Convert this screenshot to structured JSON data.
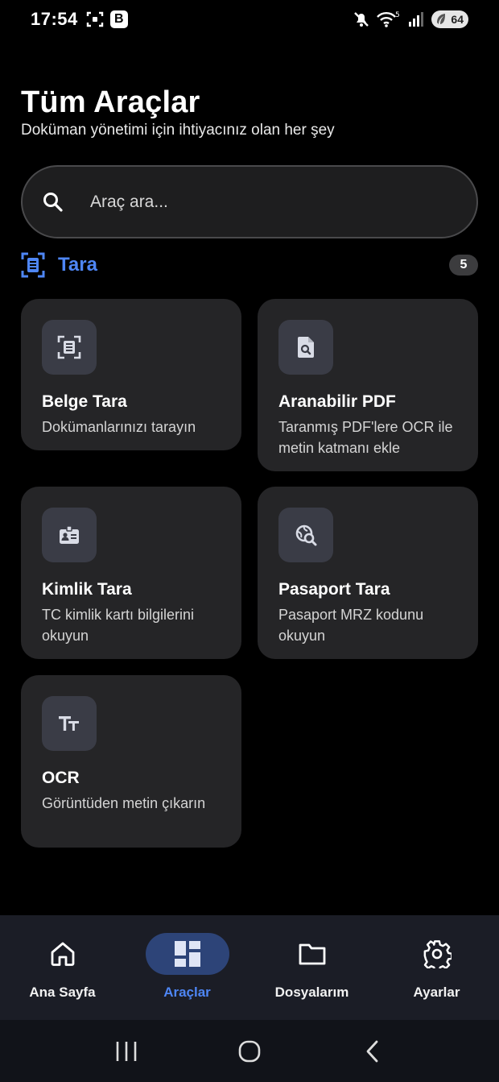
{
  "status_bar": {
    "time": "17:54",
    "badge_letter": "B",
    "wifi_level": "5",
    "battery": "64"
  },
  "header": {
    "title": "Tüm Araçlar",
    "subtitle": "Doküman yönetimi için ihtiyacınız olan her şey"
  },
  "search": {
    "placeholder": "Araç ara..."
  },
  "section": {
    "title": "Tara",
    "count": "5",
    "accent_color": "#4e86f5"
  },
  "tools": [
    {
      "icon": "document-scan-icon",
      "title": "Belge Tara",
      "description": "Dokümanlarınızı tarayın"
    },
    {
      "icon": "searchable-pdf-icon",
      "title": "Aranabilir PDF",
      "description": "Taranmış PDF'lere OCR ile metin katmanı ekle"
    },
    {
      "icon": "id-card-icon",
      "title": "Kimlik Tara",
      "description": "TC kimlik kartı bilgilerini okuyun"
    },
    {
      "icon": "passport-search-icon",
      "title": "Pasaport Tara",
      "description": "Pasaport MRZ kodunu okuyun"
    },
    {
      "icon": "text-size-icon",
      "title": "OCR",
      "description": "Görüntüden metin çıkarın"
    }
  ],
  "bottom_nav": {
    "items": [
      {
        "icon": "home-icon",
        "label": "Ana Sayfa",
        "active": false
      },
      {
        "icon": "dashboard-icon",
        "label": "Araçlar",
        "active": true
      },
      {
        "icon": "folder-icon",
        "label": "Dosyalarım",
        "active": false
      },
      {
        "icon": "gear-icon",
        "label": "Ayarlar",
        "active": false
      }
    ]
  },
  "system_nav": {
    "buttons": [
      "recents-icon",
      "home-circle-icon",
      "back-icon"
    ]
  }
}
